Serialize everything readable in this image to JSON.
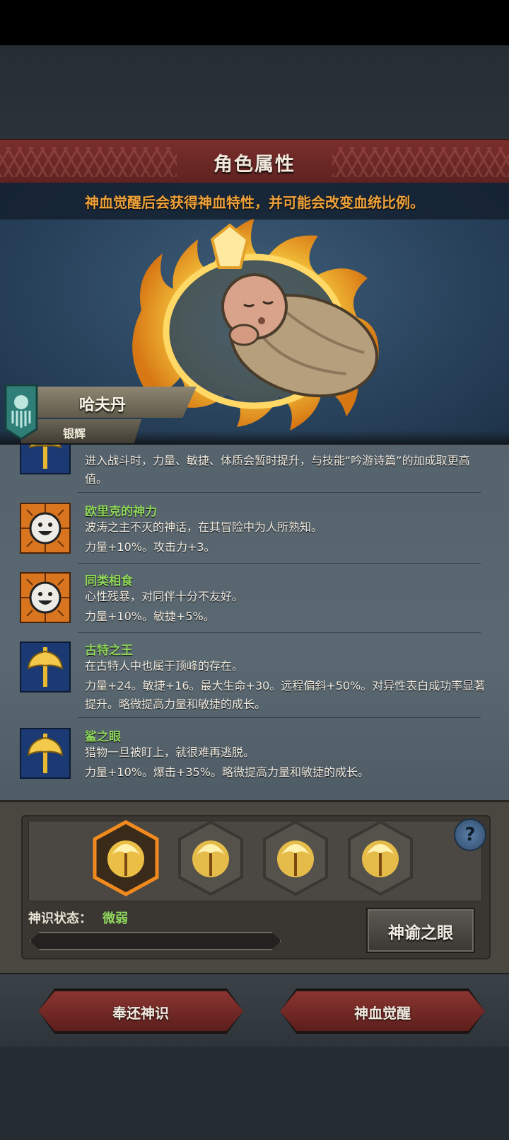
{
  "header": {
    "title": "角色属性"
  },
  "hero": {
    "notice": "神血觉醒后会获得神血特性，并可能会改变血统比例。",
    "name": "哈夫丹",
    "rank": "银辉"
  },
  "traits": [
    {
      "icon": "golden-axe-icon",
      "name": "",
      "desc": "",
      "effect": "进入战斗时，力量、敏捷、体质会暂时提升，与技能“吟游诗篇”的加成取更高值。"
    },
    {
      "icon": "smiley-face-icon",
      "name": "欧里克的神力",
      "desc": "波涛之主不灭的神话，在其冒险中为人所熟知。",
      "effect": "力量+10%。攻击力+3。"
    },
    {
      "icon": "smiley-face-icon",
      "name": "同类相食",
      "desc": "心性残暴，对同伴十分不友好。",
      "effect": "力量+10%。敏捷+5%。"
    },
    {
      "icon": "golden-axe-icon",
      "name": "古特之王",
      "desc": "在古特人中也属于顶峰的存在。",
      "effect": "力量+24。敏捷+16。最大生命+30。远程偏斜+50%。对异性表白成功率显著提升。略微提高力量和敏捷的成长。"
    },
    {
      "icon": "golden-axe-icon",
      "name": "鲨之眼",
      "desc": "猎物一旦被盯上，就很难再逃脱。",
      "effect": "力量+10%。爆击+35%。略微提高力量和敏捷的成长。"
    }
  ],
  "slots": {
    "items": [
      {
        "icon": "divine-flame-slot-icon",
        "selected": true
      },
      {
        "icon": "divine-flame-slot-icon",
        "selected": false
      },
      {
        "icon": "divine-flame-slot-icon",
        "selected": false
      },
      {
        "icon": "divine-flame-slot-icon",
        "selected": false
      }
    ],
    "help_label": "?",
    "state_label": "神识状态：",
    "state_value": "微弱",
    "progress": 0,
    "oracle_label": "神谕之眼"
  },
  "actions": {
    "return_label": "奉还神识",
    "awaken_label": "神血觉醒"
  },
  "colors": {
    "accent_orange": "#f0a23a",
    "trait_green": "#8fd65c",
    "banner_red": "#7a2f2c"
  }
}
